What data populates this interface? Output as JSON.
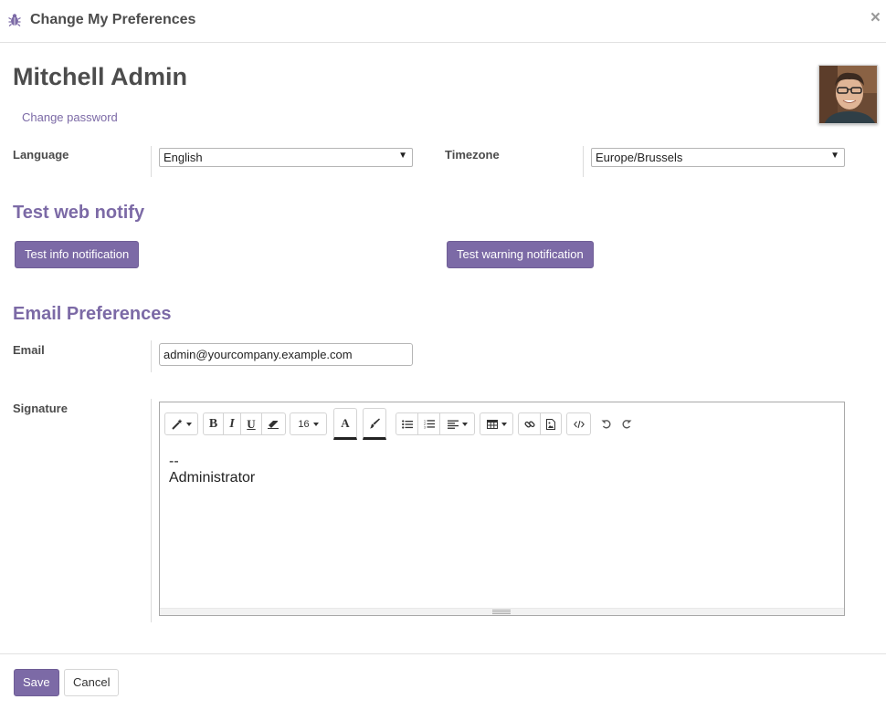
{
  "dialog": {
    "title": "Change My Preferences",
    "close_glyph": "×"
  },
  "user": {
    "name": "Mitchell Admin",
    "change_password_label": "Change password"
  },
  "fields": {
    "language": {
      "label": "Language",
      "value": "English"
    },
    "timezone": {
      "label": "Timezone",
      "value": "Europe/Brussels"
    },
    "email": {
      "label": "Email",
      "value": "admin@yourcompany.example.com"
    },
    "signature": {
      "label": "Signature"
    }
  },
  "test_web_notify": {
    "title": "Test web notify",
    "info_button": "Test info notification",
    "warning_button": "Test warning notification"
  },
  "email_preferences": {
    "title": "Email Preferences"
  },
  "editor": {
    "font_size": "16",
    "content_lines": [
      "--",
      "Administrator"
    ],
    "toolbar_icons": [
      "magic-wand-icon",
      "bold-icon",
      "italic-icon",
      "underline-icon",
      "eraser-icon",
      "font-size-select",
      "font-color-icon",
      "highlight-brush-icon",
      "bullet-list-icon",
      "numbered-list-icon",
      "align-icon",
      "table-icon",
      "link-icon",
      "image-icon",
      "code-view-icon",
      "undo-icon",
      "redo-icon"
    ]
  },
  "footer": {
    "save_label": "Save",
    "cancel_label": "Cancel"
  },
  "colors": {
    "accent": "#7c6aa6",
    "text": "#4c4c4c"
  }
}
